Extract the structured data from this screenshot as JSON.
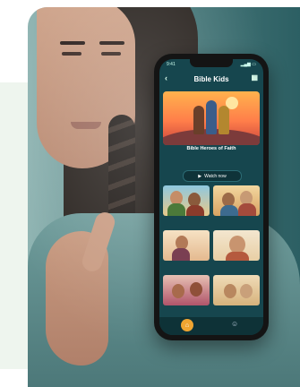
{
  "colors": {
    "panel": "#eef5ee",
    "app_bg": "#16464e",
    "accent": "#f0a531"
  },
  "app": {
    "status_time": "9:41",
    "status_icons": "▂▄▆ ▭",
    "header_title": "Bible Kids",
    "hero_title": "Bible Heroes of Faith",
    "hero_description": "",
    "watch_label": "Watch now",
    "tiles": [
      {
        "caption": ""
      },
      {
        "caption": ""
      },
      {
        "caption": ""
      },
      {
        "caption": ""
      },
      {
        "caption": ""
      },
      {
        "caption": ""
      }
    ],
    "nav": {
      "home_label": "",
      "more_label": ""
    }
  }
}
